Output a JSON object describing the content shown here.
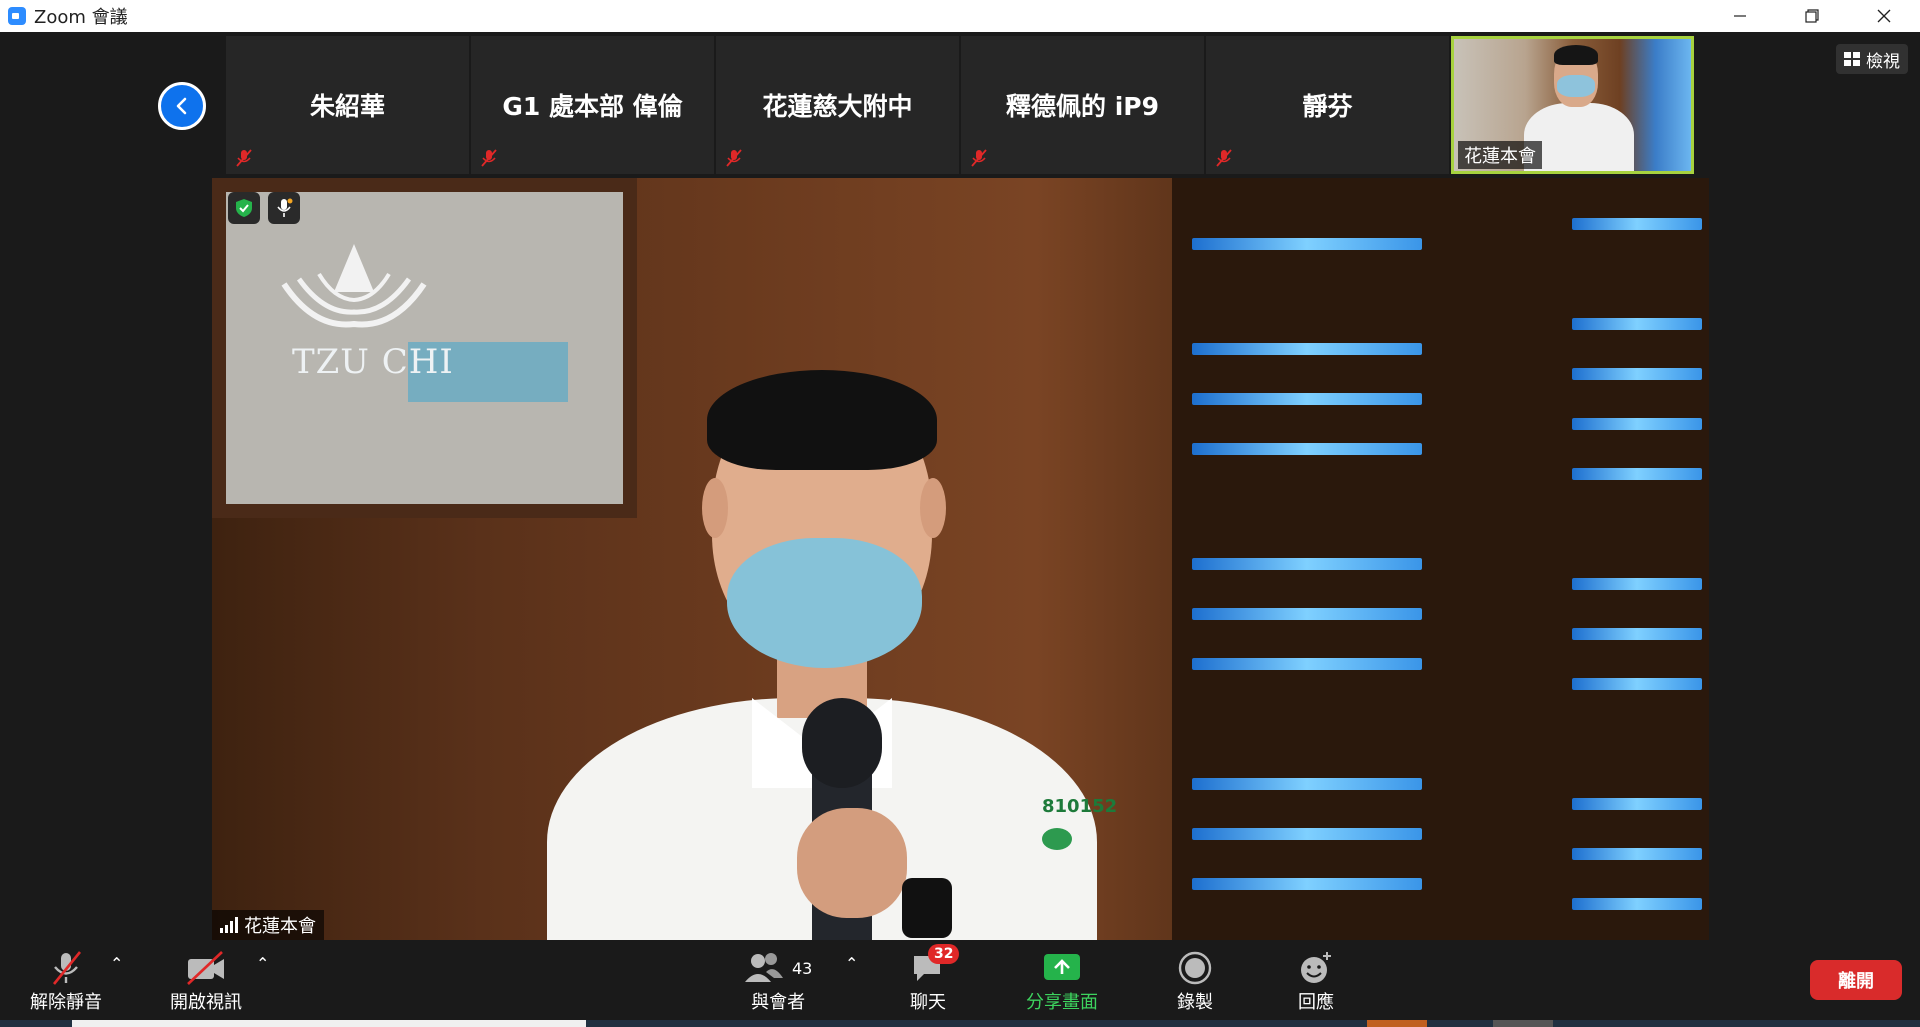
{
  "window": {
    "title": "Zoom 會議"
  },
  "gallery": {
    "participants": [
      {
        "name": "朱紹華"
      },
      {
        "name": "G1 處本部 偉倫"
      },
      {
        "name": "花蓮慈大附中"
      },
      {
        "name": "釋德佩的 iP9"
      },
      {
        "name": "靜芬"
      }
    ],
    "self_tile_name": "花蓮本會",
    "view_label": "檢視"
  },
  "main_video": {
    "speaker_name": "花蓮本會",
    "logo_text": "TZU CHI",
    "badge_number": "810152"
  },
  "toolbar": {
    "unmute_label": "解除靜音",
    "start_video_label": "開啟視訊",
    "participants_label": "與會者",
    "participants_count": "43",
    "chat_label": "聊天",
    "chat_badge": "32",
    "share_label": "分享畫面",
    "record_label": "錄製",
    "reactions_label": "回應",
    "leave_label": "離開"
  },
  "colors": {
    "accent_blue": "#0e72ed",
    "share_green": "#3dd35e",
    "leave_red": "#d92b2b",
    "active_speaker_border": "#a7d23f",
    "muted_red": "#e02828"
  }
}
